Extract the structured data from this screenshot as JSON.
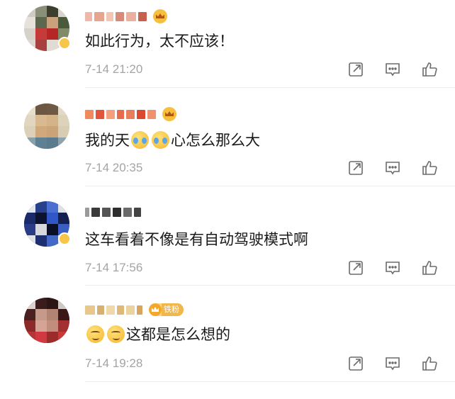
{
  "comments": [
    {
      "text": "如此行为，太不应该！",
      "time": "7-14 21:20",
      "emojis": []
    },
    {
      "text_before": "我的天",
      "text_after": "心怎么那么大",
      "time": "7-14 20:35",
      "emojis": [
        "cry-laugh-icon",
        "cry-laugh-icon"
      ]
    },
    {
      "text": "这车看着不像是有自动驾驶模式啊",
      "time": "7-14 17:56",
      "emojis": []
    },
    {
      "text": "这都是怎么想的",
      "time": "7-14 19:28",
      "emojis": [
        "sweat-icon",
        "sweat-icon"
      ],
      "badge": "铁粉"
    }
  ],
  "icons": {
    "share": "share-icon",
    "reply": "comment-icon",
    "like": "thumb-up-icon"
  },
  "colors": {
    "time": "#a4a4a4",
    "crown": "#f6c03c",
    "fan_badge": "#f1b74a"
  }
}
